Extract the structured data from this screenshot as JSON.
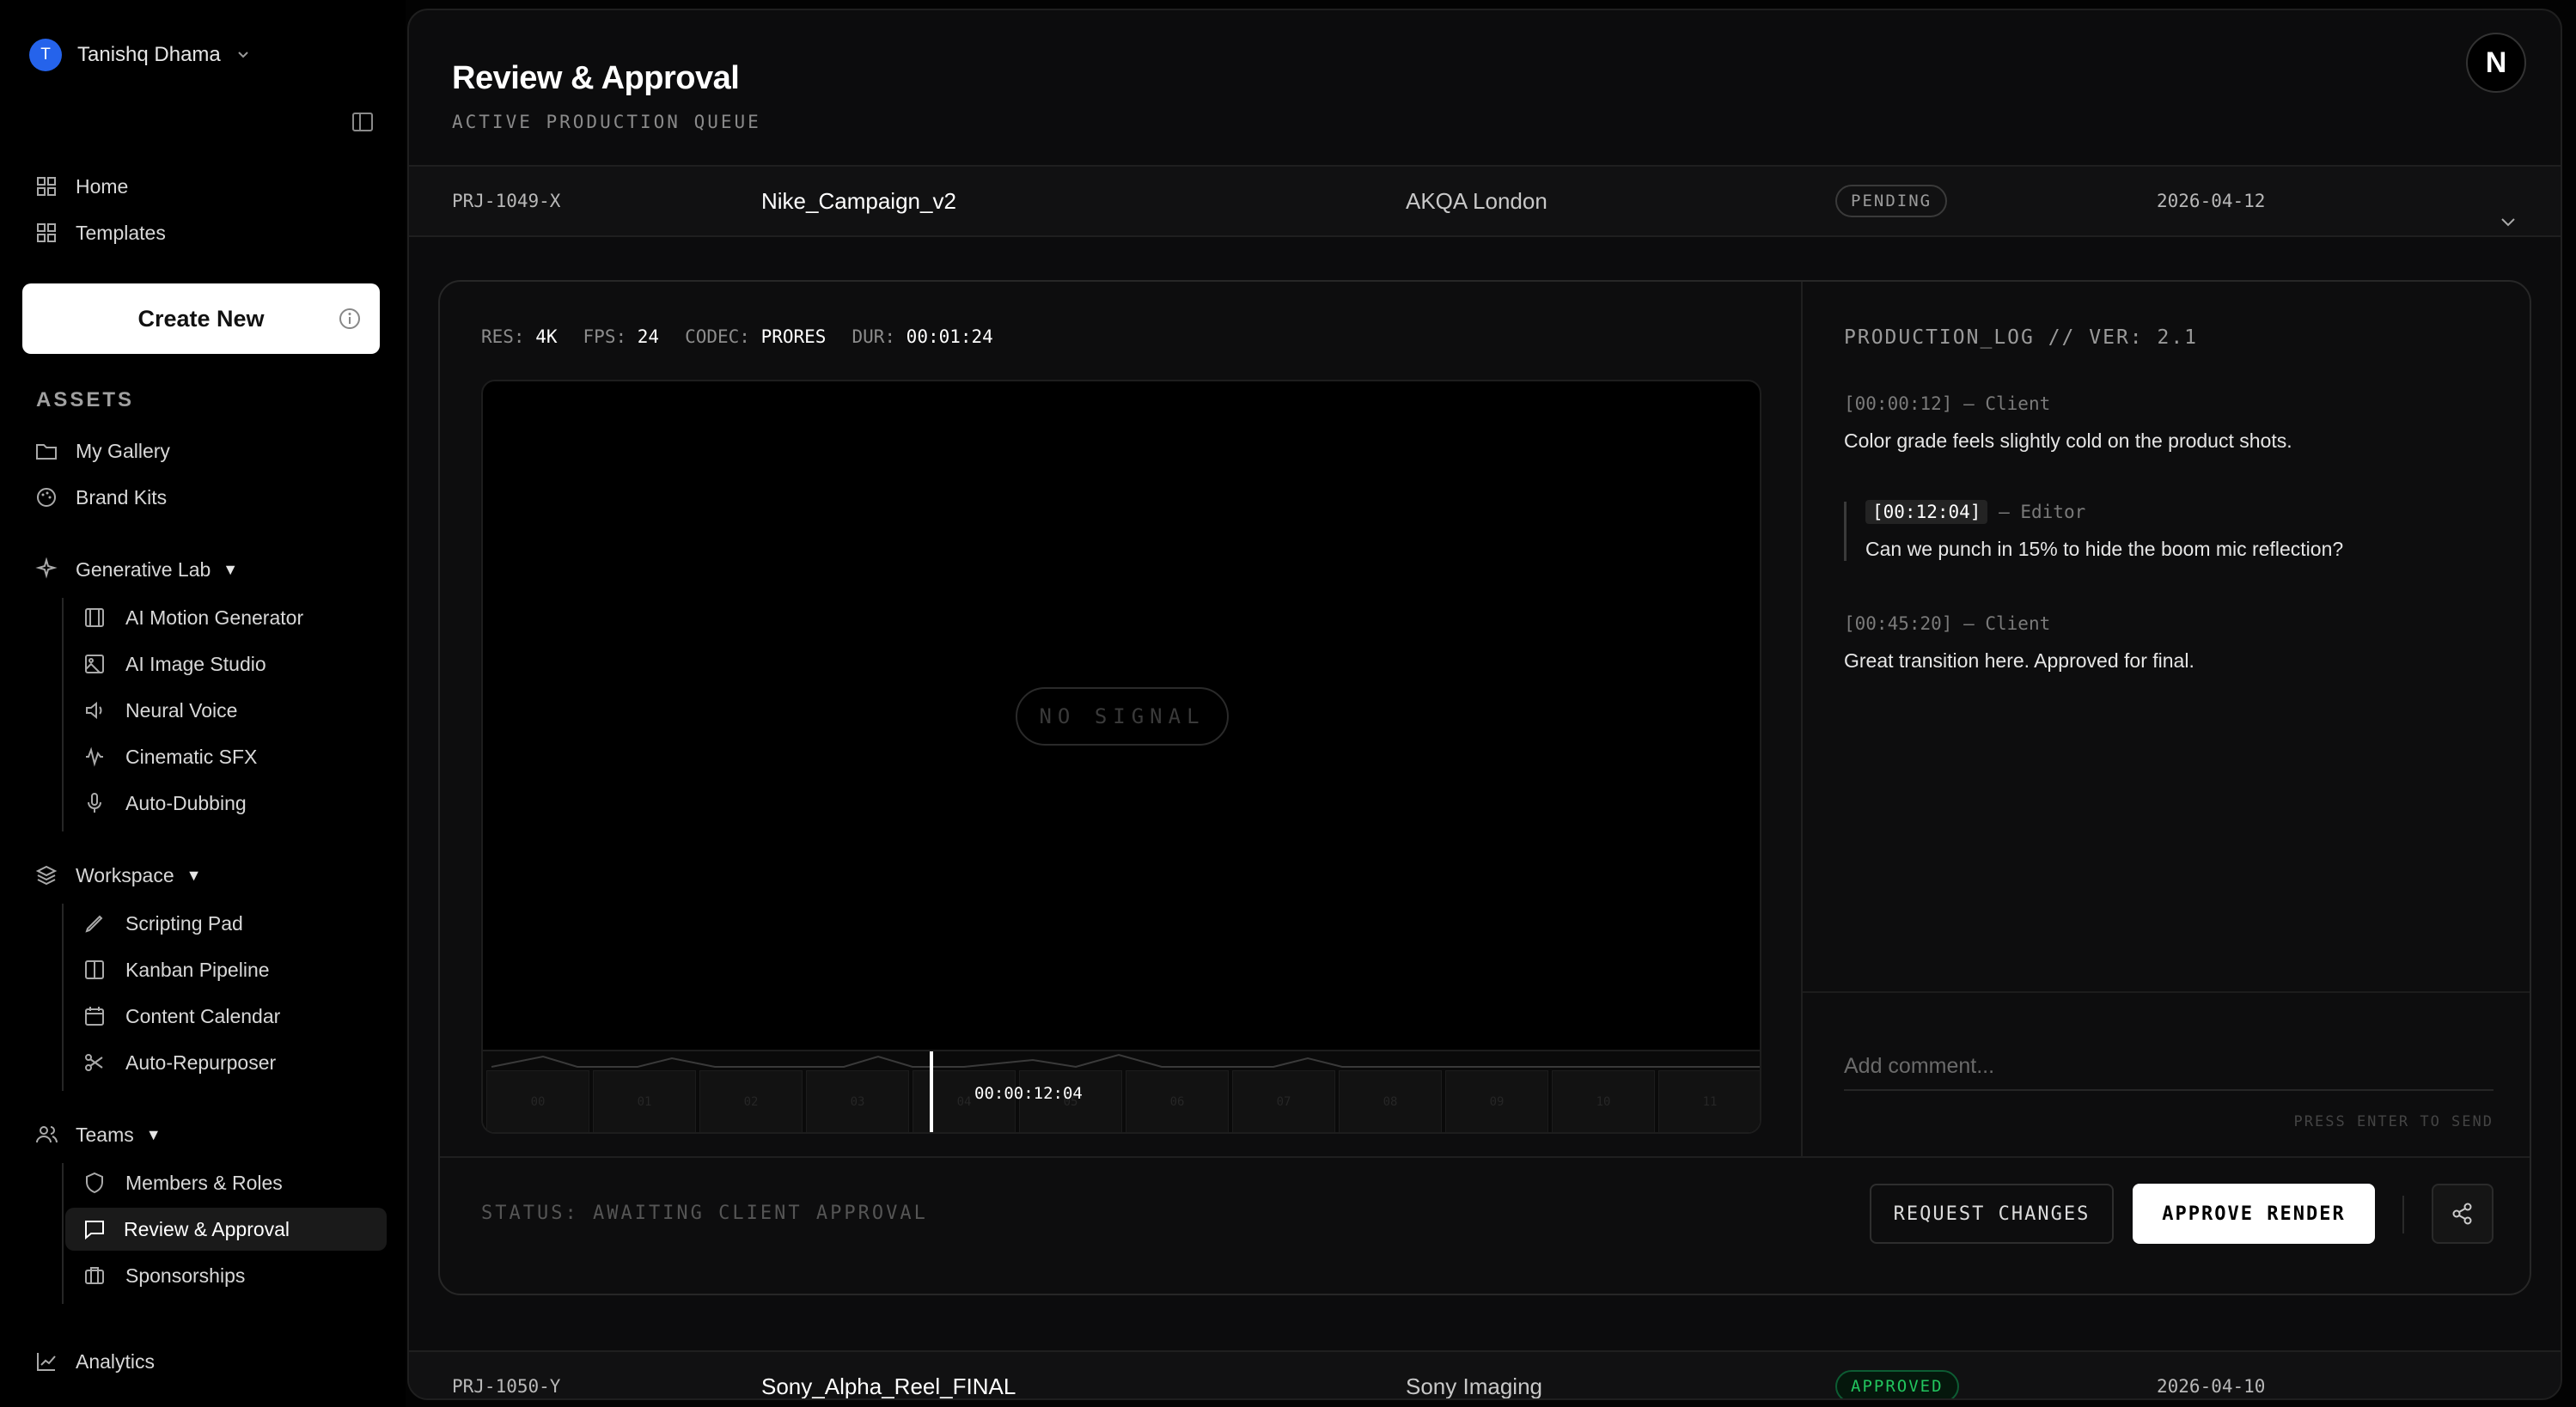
{
  "user": {
    "initial": "T",
    "name": "Tanishq Dhama",
    "avatar_color": "#2563eb"
  },
  "sidebar": {
    "home": "Home",
    "templates": "Templates",
    "create_new": "Create New",
    "assets_label": "ASSETS",
    "my_gallery": "My Gallery",
    "brand_kits": "Brand Kits",
    "generative_lab": {
      "label": "Generative Lab",
      "arrow": "▼",
      "items": [
        "AI Motion Generator",
        "AI Image Studio",
        "Neural Voice",
        "Cinematic SFX",
        "Auto-Dubbing"
      ]
    },
    "workspace": {
      "label": "Workspace",
      "arrow": "▼",
      "items": [
        "Scripting Pad",
        "Kanban Pipeline",
        "Content Calendar",
        "Auto-Repurposer"
      ]
    },
    "teams": {
      "label": "Teams",
      "arrow": "▼",
      "items": [
        "Members & Roles",
        "Review & Approval",
        "Sponsorships"
      ]
    },
    "analytics": "Analytics"
  },
  "header": {
    "title": "Review & Approval",
    "subtitle": "ACTIVE PRODUCTION QUEUE",
    "logo_letter": "N"
  },
  "rows": [
    {
      "id": "PRJ-1049-X",
      "name": "Nike_Campaign_v2",
      "client": "AKQA London",
      "status": "PENDING",
      "date": "2026-04-12"
    },
    {
      "id": "PRJ-1050-Y",
      "name": "Sony_Alpha_Reel_FINAL",
      "client": "Sony Imaging",
      "status": "APPROVED",
      "date": "2026-04-10"
    }
  ],
  "meta": {
    "res_label": "RES:",
    "res": "4K",
    "fps_label": "FPS:",
    "fps": "24",
    "codec_label": "CODEC:",
    "codec": "PRORES",
    "dur_label": "DUR:",
    "dur": "00:01:24"
  },
  "player": {
    "no_signal": "NO SIGNAL",
    "timecode": "00:00:12:04",
    "frames": [
      "00",
      "01",
      "02",
      "03",
      "04",
      "05",
      "06",
      "07",
      "08",
      "09",
      "10",
      "11"
    ]
  },
  "log": {
    "heading": "PRODUCTION_LOG // VER: 2.1",
    "entries": [
      {
        "ts": "[00:00:12]",
        "author": "— Client",
        "text": "Color grade feels slightly cold on the product shots."
      },
      {
        "ts": "[00:12:04]",
        "author": "— Editor",
        "text": "Can we punch in 15% to hide the boom mic reflection?"
      },
      {
        "ts": "[00:45:20]",
        "author": "— Client",
        "text": "Great transition here. Approved for final."
      }
    ],
    "placeholder": "Add comment...",
    "hint": "PRESS ENTER TO SEND"
  },
  "footer": {
    "status": "STATUS: AWAITING CLIENT APPROVAL",
    "request_changes": "REQUEST CHANGES",
    "approve_render": "APPROVE RENDER"
  },
  "colors": {
    "approved": "#22c55e",
    "accent": "#2563eb"
  }
}
